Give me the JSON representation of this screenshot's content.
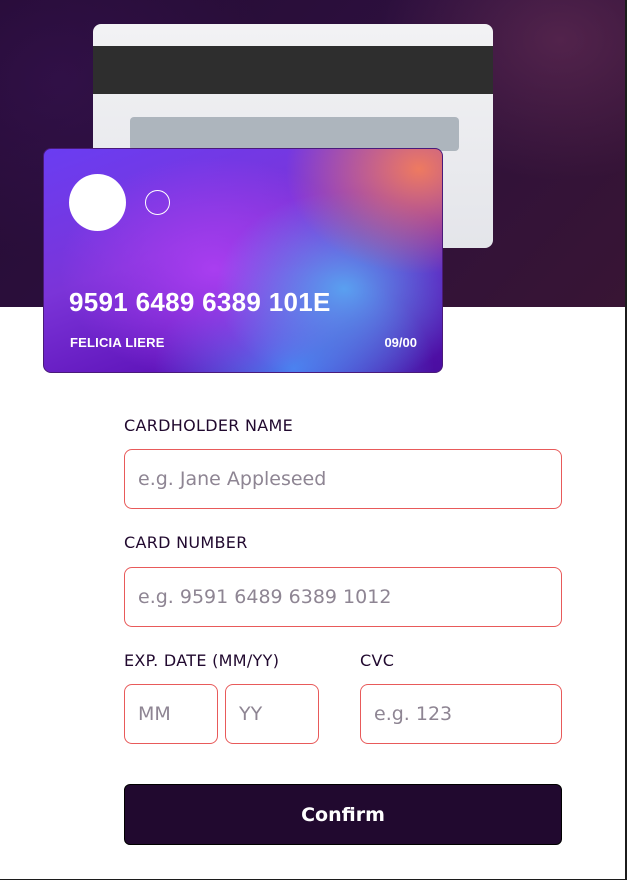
{
  "card_front": {
    "number": "9591 6489 6389 101E",
    "holder": "FELICIA LIERE",
    "expiry": "09/00"
  },
  "card_back": {
    "cvc": ""
  },
  "form": {
    "cardholder": {
      "label": "CARDHOLDER NAME",
      "placeholder": "e.g. Jane Appleseed",
      "value": ""
    },
    "number": {
      "label": "CARD NUMBER",
      "placeholder": "e.g. 9591 6489 6389 1012",
      "value": ""
    },
    "expiry": {
      "label": "EXP. DATE (MM/YY)",
      "mm_placeholder": "MM",
      "yy_placeholder": "YY"
    },
    "cvc": {
      "label": "CVC",
      "placeholder": "e.g. 123",
      "value": ""
    },
    "confirm_label": "Confirm"
  },
  "colors": {
    "accent_dark": "#21092f",
    "error_border": "#e85a5a",
    "placeholder": "#8e8593"
  }
}
